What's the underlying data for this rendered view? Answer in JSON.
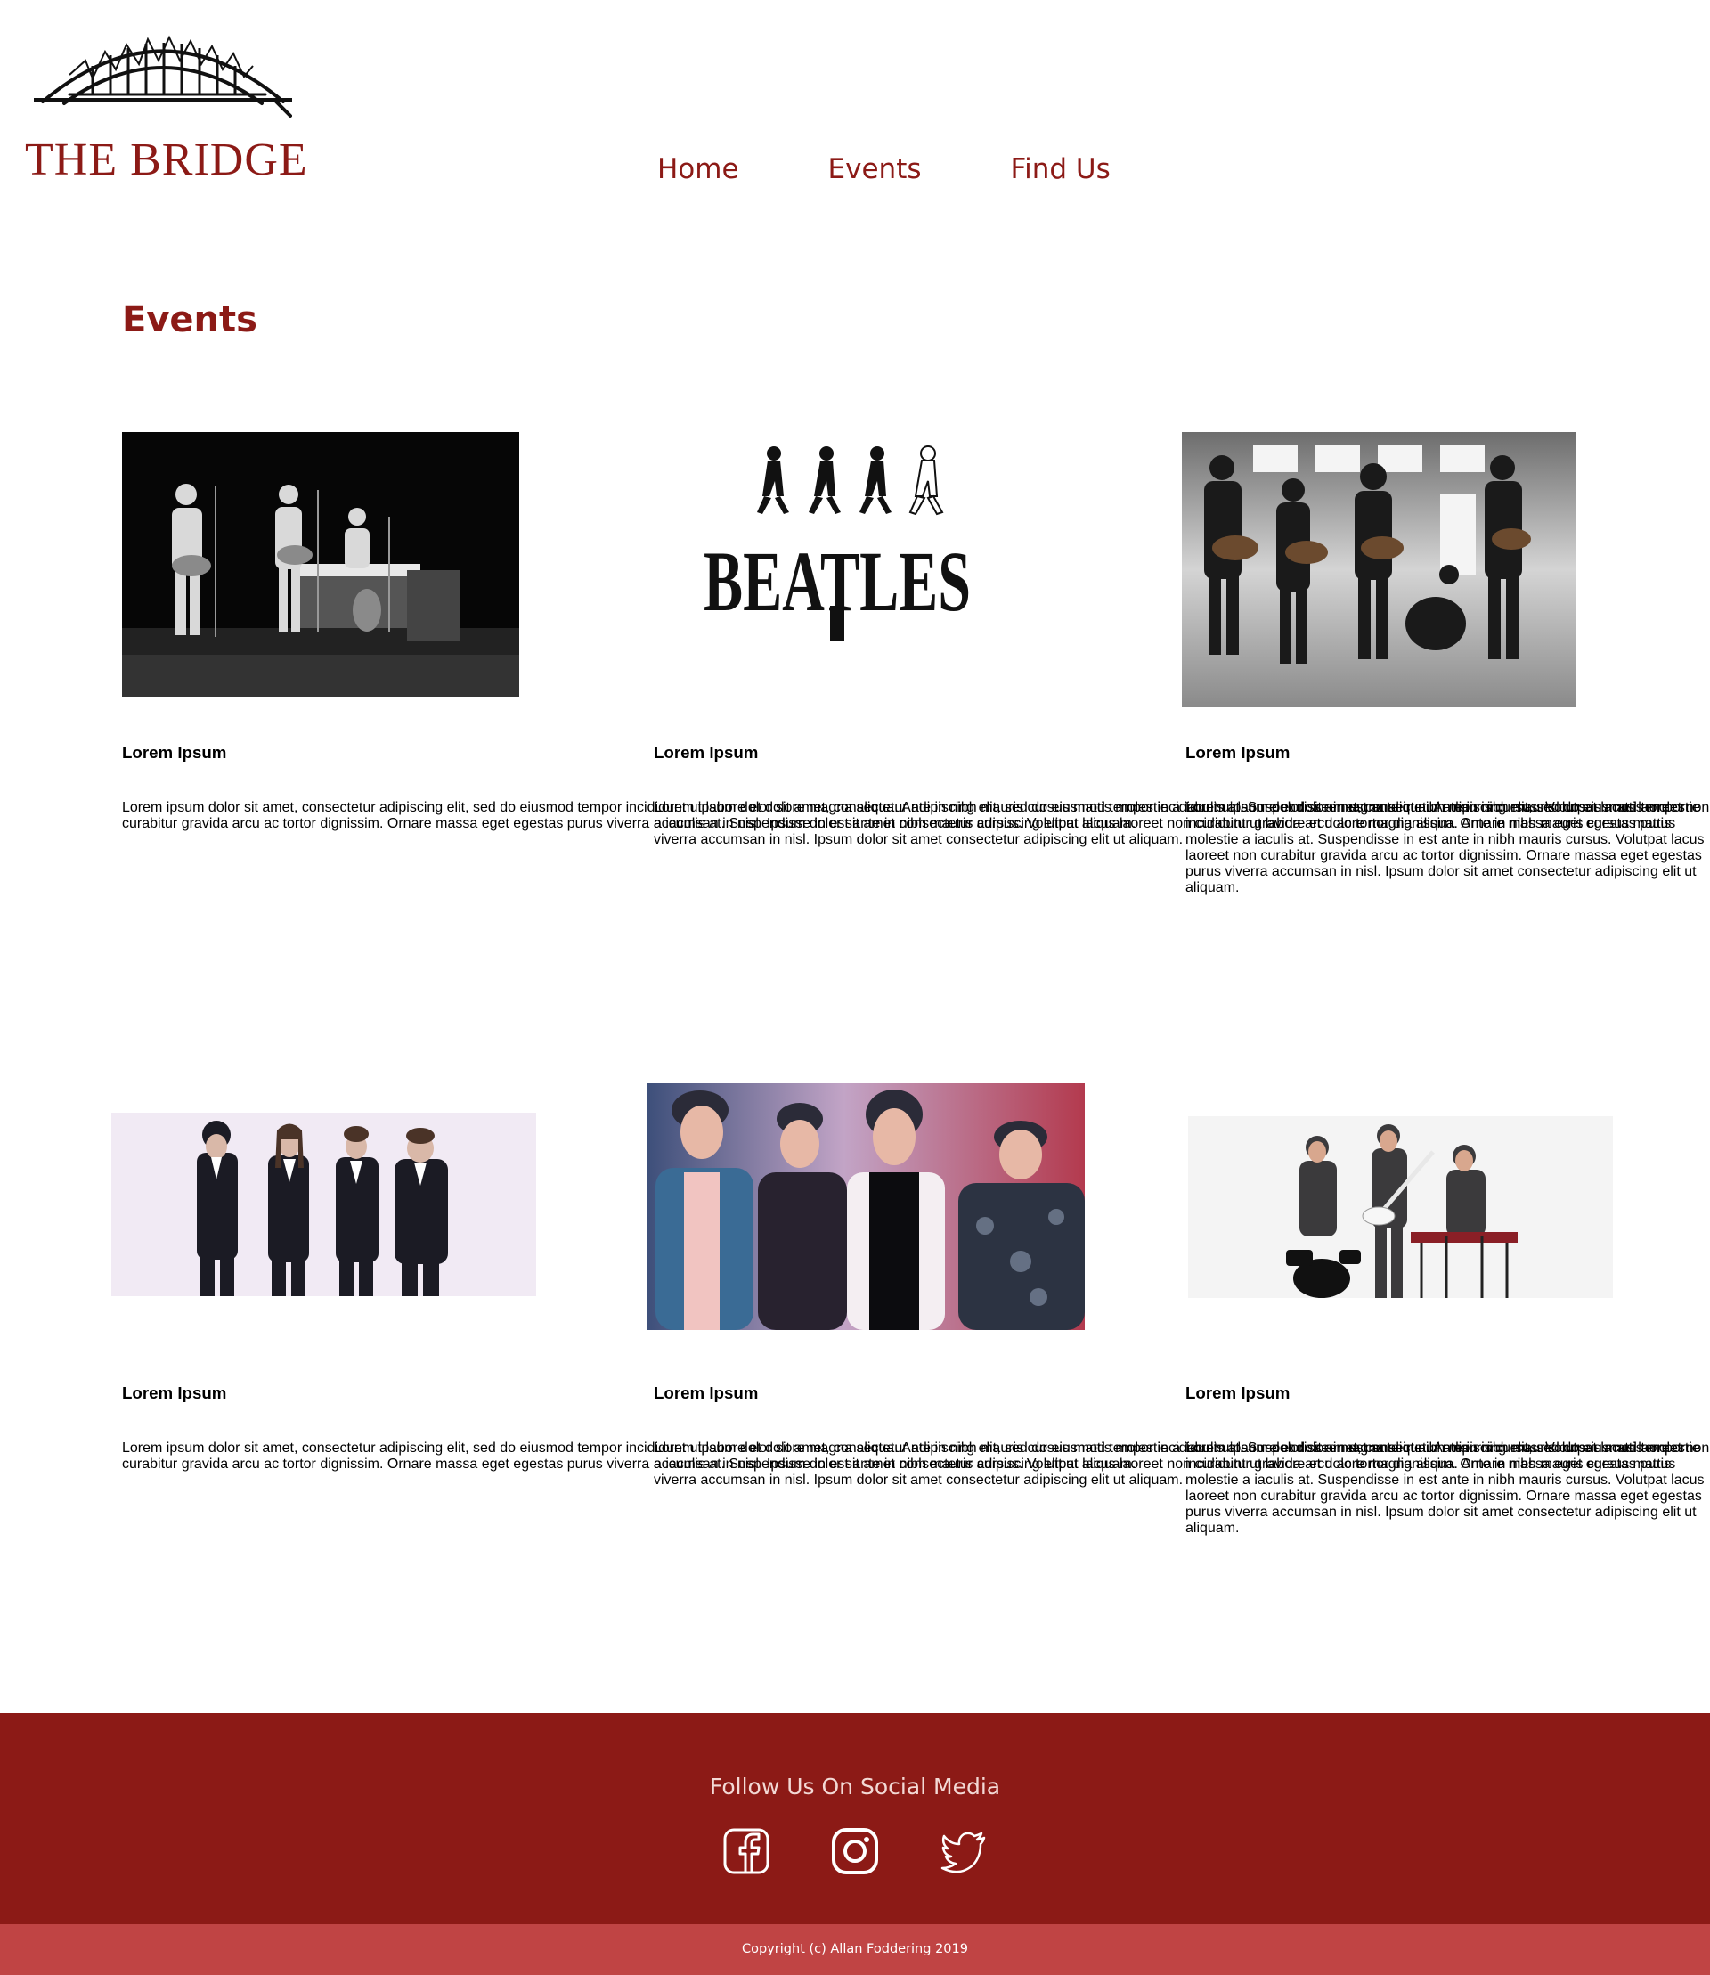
{
  "site": {
    "logo_text": "THE BRIDGE",
    "nav": [
      {
        "label": "Home"
      },
      {
        "label": "Events"
      },
      {
        "label": "Find Us"
      }
    ]
  },
  "page": {
    "title": "Events"
  },
  "events": [
    {
      "image": "band-on-stage-photo",
      "title": "Lorem Ipsum",
      "text": "Lorem ipsum dolor sit amet, consectetur adipiscing elit, sed do eiusmod tempor incididunt ut labore et dolore magna aliqua. Ante in nibh mauris cursus mattis molestie a iaculis at. Suspendisse in est ante in nibh mauris cursus. Volutpat lacus laoreet non curabitur gravida arcu ac tortor dignissim. Ornare massa eget egestas purus viverra accumsan in nisl. Ipsum dolor sit amet consectetur adipiscing elit ut aliquam."
    },
    {
      "image": "beatles-logo",
      "logo_text": "BEATLES",
      "title": "Lorem Ipsum",
      "text": "Lorem ipsum dolor sit amet, consectetur adipiscing elit, sed do eiusmod tempor incididunt ut labore et dolore magna aliqua. Ante in nibh mauris cursus mattis molestie a iaculis at. Suspendisse in est ante in nibh mauris cursus. Volutpat lacus laoreet non curabitur gravida arcu ac tortor dignissim. Ornare massa eget egestas purus viverra accumsan in nisl. Ipsum dolor sit amet consectetur adipiscing elit ut aliquam."
    },
    {
      "image": "band-rehearsal-photo",
      "title": "Lorem Ipsum",
      "text": "Lorem ipsum dolor sit amet, consectetur adipiscing elit, sed do eiusmod tempor incididunt ut labore et dolore magna aliqua. Ante in nibh mauris cursus mattis molestie a iaculis at. Suspendisse in est ante in nibh mauris cursus. Volutpat lacus laoreet non curabitur gravida arcu ac tortor dignissim. Ornare massa eget egestas purus viverra accumsan in nisl. Ipsum dolor sit amet consectetur adipiscing elit ut aliquam."
    },
    {
      "image": "band-in-suits-photo",
      "title": "Lorem Ipsum",
      "text": "Lorem ipsum dolor sit amet, consectetur adipiscing elit, sed do eiusmod tempor incididunt ut labore et dolore magna aliqua. Ante in nibh mauris cursus mattis molestie a iaculis at. Suspendisse in est ante in nibh mauris cursus. Volutpat lacus laoreet non curabitur gravida arcu ac tortor dignissim. Ornare massa eget egestas purus viverra accumsan in nisl. Ipsum dolor sit amet consectetur adipiscing elit ut aliquam."
    },
    {
      "image": "band-portrait-photo",
      "title": "Lorem Ipsum",
      "text": "Lorem ipsum dolor sit amet, consectetur adipiscing elit, sed do eiusmod tempor incididunt ut labore et dolore magna aliqua. Ante in nibh mauris cursus mattis molestie a iaculis at. Suspendisse in est ante in nibh mauris cursus. Volutpat lacus laoreet non curabitur gravida arcu ac tortor dignissim. Ornare massa eget egestas purus viverra accumsan in nisl. Ipsum dolor sit amet consectetur adipiscing elit ut aliquam."
    },
    {
      "image": "trio-band-photo",
      "title": "Lorem Ipsum",
      "text": "Lorem ipsum dolor sit amet, consectetur adipiscing elit, sed do eiusmod tempor incididunt ut labore et dolore magna aliqua. Ante in nibh mauris cursus mattis molestie a iaculis at. Suspendisse in est ante in nibh mauris cursus. Volutpat lacus laoreet non curabitur gravida arcu ac tortor dignissim. Ornare massa eget egestas purus viverra accumsan in nisl. Ipsum dolor sit amet consectetur adipiscing elit ut aliquam."
    }
  ],
  "footer": {
    "title": "Follow Us On Social Media",
    "social": [
      {
        "icon": "facebook-icon"
      },
      {
        "icon": "instagram-icon"
      },
      {
        "icon": "twitter-icon"
      }
    ],
    "copyright": "Copyright (c) Allan Foddering 2019"
  },
  "colors": {
    "brand": "#8c1a16",
    "copyright_bar": "#c04444",
    "body_text": "#6b4e4b",
    "footer_text": "#f3d9d5"
  }
}
